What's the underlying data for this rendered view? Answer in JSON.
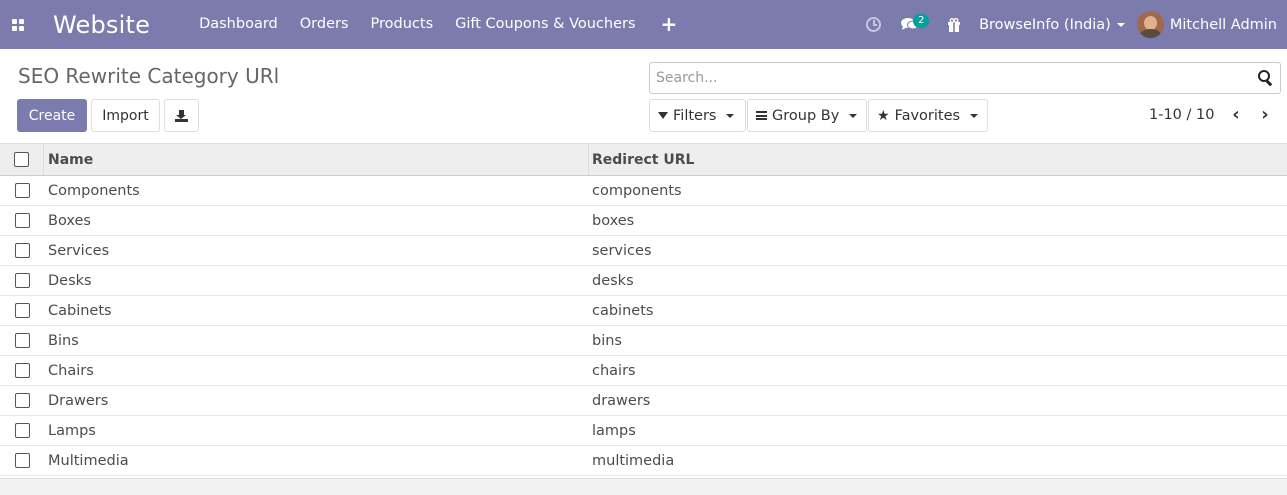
{
  "navbar": {
    "brand": "Website",
    "menu": [
      "Dashboard",
      "Orders",
      "Products",
      "Gift Coupons & Vouchers"
    ],
    "plus_icon": "+",
    "chat_count": "2",
    "company": "BrowseInfo (India)",
    "user": "Mitchell Admin",
    "bg_color": "#7c7bad"
  },
  "page": {
    "title": "SEO Rewrite Category URl",
    "create_label": "Create",
    "import_label": "Import",
    "search_placeholder": "Search...",
    "filters_label": "Filters",
    "groupby_label": "Group By",
    "favorites_label": "Favorites",
    "pager": "1-10 / 10"
  },
  "table": {
    "headers": [
      "Name",
      "Redirect URL"
    ],
    "rows": [
      {
        "name": "Components",
        "url": "components"
      },
      {
        "name": "Boxes",
        "url": "boxes"
      },
      {
        "name": "Services",
        "url": "services"
      },
      {
        "name": "Desks",
        "url": "desks"
      },
      {
        "name": "Cabinets",
        "url": "cabinets"
      },
      {
        "name": "Bins",
        "url": "bins"
      },
      {
        "name": "Chairs",
        "url": "chairs"
      },
      {
        "name": "Drawers",
        "url": "drawers"
      },
      {
        "name": "Lamps",
        "url": "lamps"
      },
      {
        "name": "Multimedia",
        "url": "multimedia"
      }
    ]
  }
}
